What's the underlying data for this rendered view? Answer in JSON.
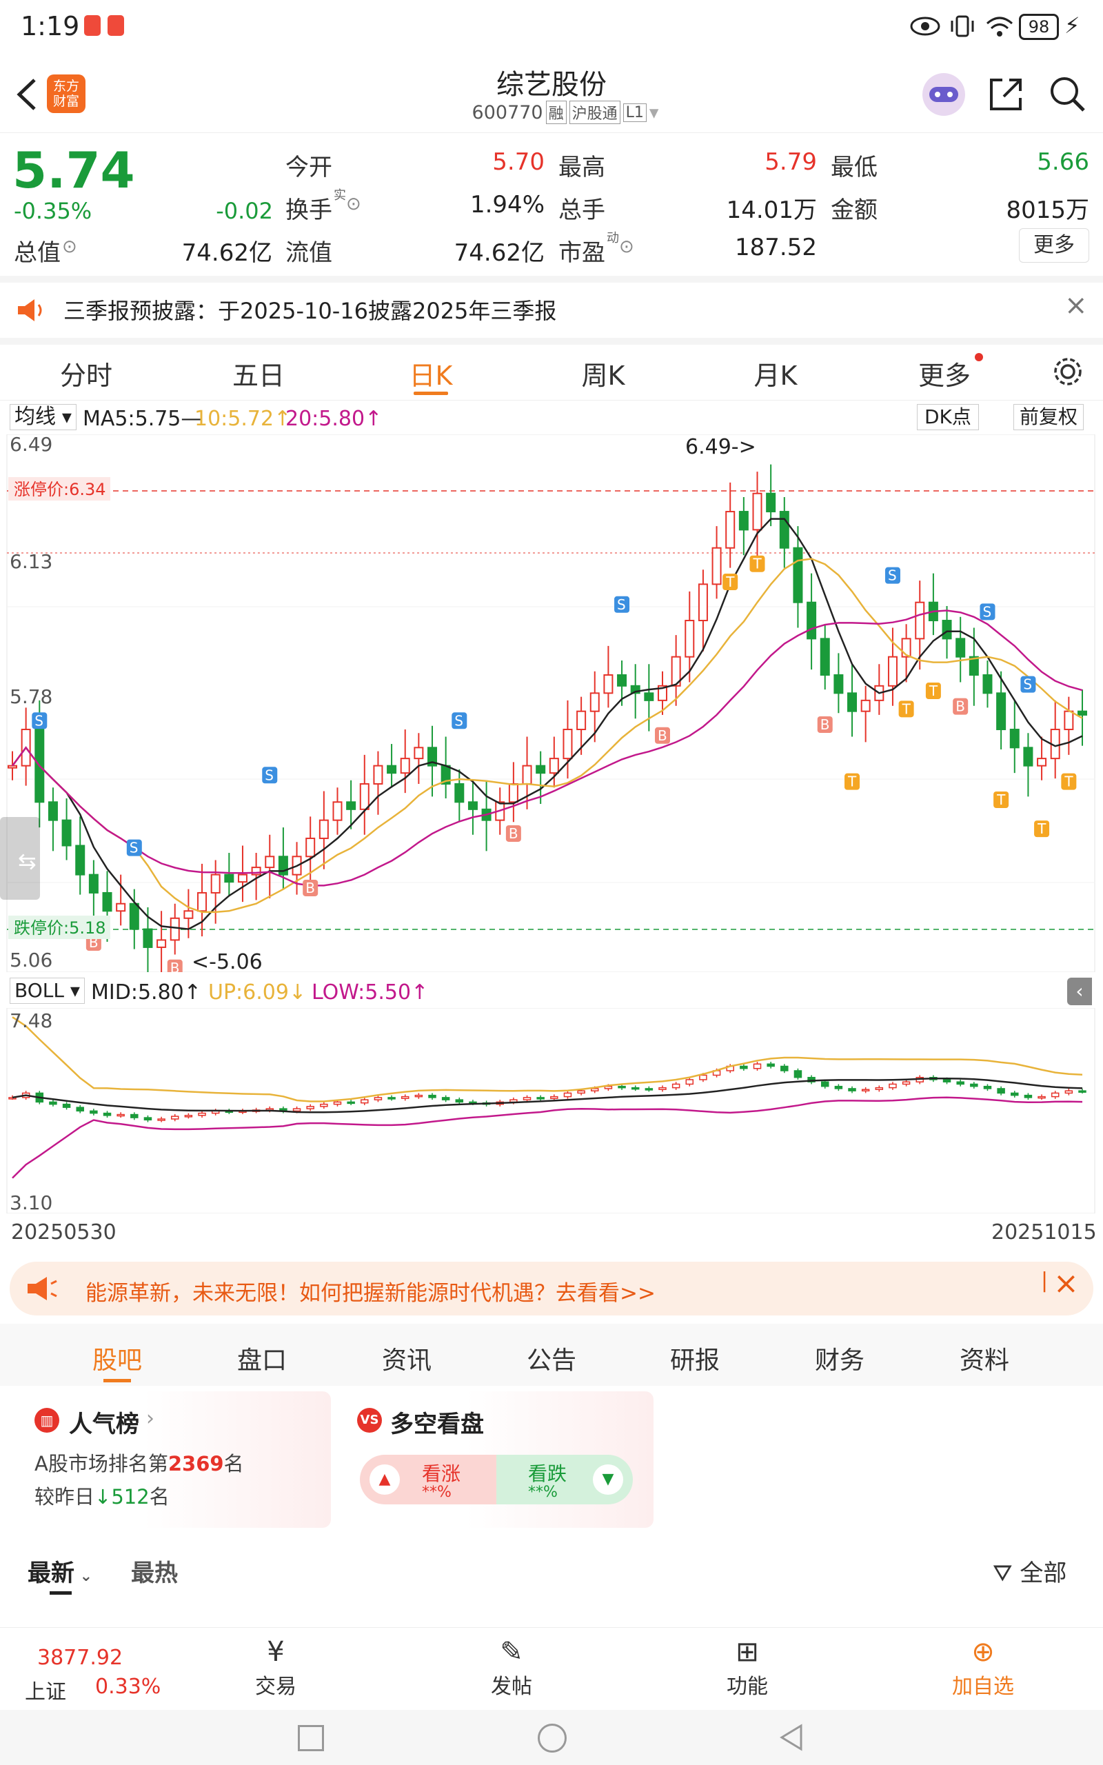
{
  "status_bar": {
    "time": "1:19",
    "battery": "98"
  },
  "header": {
    "logo_text": "东方\n财富",
    "title": "综艺股份",
    "code": "600770",
    "tags": [
      "融",
      "沪股通",
      "L1"
    ]
  },
  "quote": {
    "price": "5.74",
    "change_pct": "-0.35%",
    "change": "-0.02",
    "open_label": "今开",
    "open": "5.70",
    "high_label": "最高",
    "high": "5.79",
    "low_label": "最低",
    "low": "5.66",
    "turnover_label": "换手",
    "turnover_sup": "实",
    "turnover": "1.94%",
    "volume_label": "总手",
    "volume": "14.01万",
    "amount_label": "金额",
    "amount": "8015万",
    "total_cap_label": "总值",
    "total_cap": "74.62亿",
    "float_cap_label": "流值",
    "float_cap": "74.62亿",
    "pe_label": "市盈",
    "pe_sup": "动",
    "pe": "187.52",
    "more": "更多"
  },
  "notice": {
    "text": "三季报预披露：于2025-10-16披露2025年三季报"
  },
  "chart_tabs": [
    "分时",
    "五日",
    "日K",
    "周K",
    "月K",
    "更多"
  ],
  "chart_tabs_active": "日K",
  "ma_bar": {
    "selector": "均线",
    "ma5": "MA5:5.75—",
    "ma10": "10:5.72↑",
    "ma20": "20:5.80↑",
    "dk": "DK点",
    "fuquan": "前复权"
  },
  "kchart_labels": {
    "y_top": "6.49",
    "y_mid1": "6.13",
    "y_mid2": "5.78",
    "y_bottom": "5.06",
    "limit_up": "涨停价:6.34",
    "limit_down": "跌停价:5.18",
    "max_mark": "6.49->",
    "min_mark": "<-5.06"
  },
  "boll_bar": {
    "selector": "BOLL",
    "mid": "MID:5.80↑",
    "up": "UP:6.09↓",
    "low": "LOW:5.50↑"
  },
  "boll_labels": {
    "y_top": "7.48",
    "y_bottom": "3.10"
  },
  "date_range": {
    "start": "20250530",
    "end": "20251015"
  },
  "ad_banner": {
    "text": "能源革新，未来无限！如何把握新能源时代机遇？去看看>>"
  },
  "bottom_tabs": [
    "股吧",
    "盘口",
    "资讯",
    "公告",
    "研报",
    "财务",
    "资料"
  ],
  "bottom_tabs_active": "股吧",
  "popularity": {
    "title": "人气榜",
    "rank_prefix": "A股市场排名第",
    "rank": "2369",
    "rank_suffix": "名",
    "change_prefix": "较昨日",
    "change": "512",
    "change_suffix": "名"
  },
  "bull_bear": {
    "title": "多空看盘",
    "bull": "看涨",
    "bull_pct": "**%",
    "bear": "看跌",
    "bear_pct": "**%"
  },
  "feed_tabs": {
    "latest": "最新",
    "hottest": "最热",
    "filter": "全部"
  },
  "bottom_nav": {
    "index_value": "3877.92",
    "index_name": "上证",
    "index_change": "0.33%",
    "trade": "交易",
    "post": "发帖",
    "functions": "功能",
    "add_watch": "加自选"
  },
  "colors": {
    "up": "#e6332a",
    "down": "#1a9b3a",
    "accent": "#f07b1e",
    "ma10": "#e8b33a",
    "ma20": "#c2188b"
  }
}
